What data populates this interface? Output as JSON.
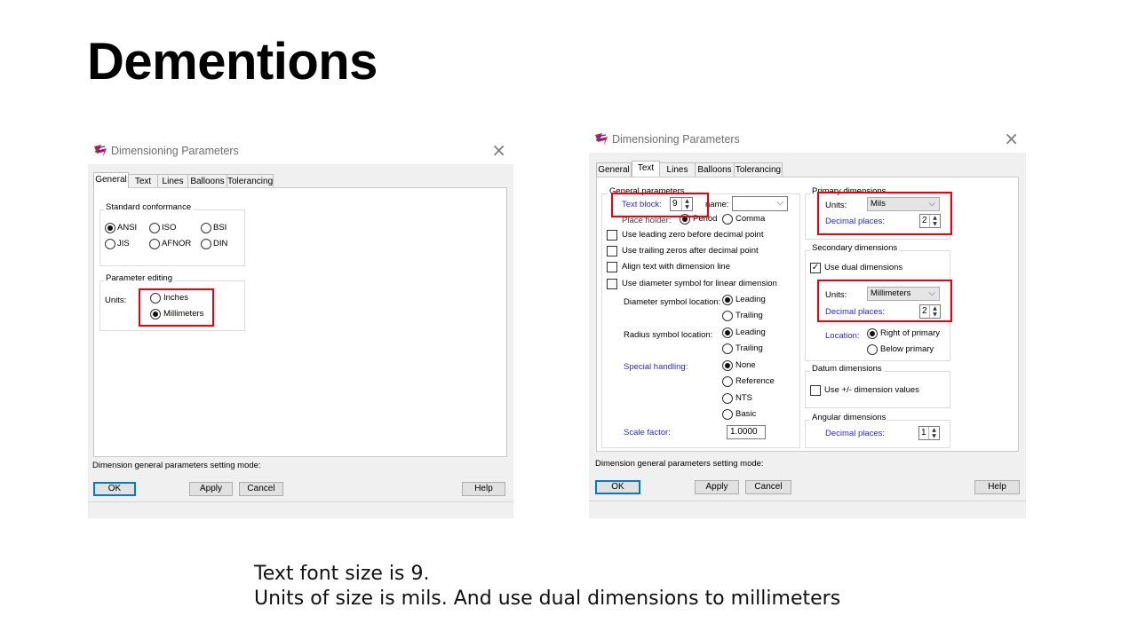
{
  "slide": {
    "title": "Dementions",
    "caption_line1": "Text font size is 9.",
    "caption_line2": "Units of size is mils. And use dual dimensions to millimeters"
  },
  "colors": {
    "highlight": "#e60012",
    "blue_label": "#2a2ad0",
    "dialog_bg": "#f0f0f0"
  },
  "dialog_left": {
    "title": "Dimensioning Parameters",
    "tabs": [
      "General",
      "Text",
      "Lines",
      "Balloons",
      "Tolerancing"
    ],
    "active_tab": "General",
    "standard_conformance": {
      "label": "Standard conformance",
      "options": [
        "ANSI",
        "ISO",
        "BSI",
        "JIS",
        "AFNOR",
        "DIN"
      ],
      "selected": "ANSI"
    },
    "parameter_editing": {
      "label": "Parameter editing",
      "units_label": "Units:",
      "options": [
        "Inches",
        "Millimeters"
      ],
      "selected": "Millimeters"
    },
    "status_text": "Dimension general parameters setting mode:",
    "buttons": {
      "ok": "OK",
      "apply": "Apply",
      "cancel": "Cancel",
      "help": "Help"
    }
  },
  "dialog_right": {
    "title": "Dimensioning Parameters",
    "tabs": [
      "General",
      "Text",
      "Lines",
      "Balloons",
      "Tolerancing"
    ],
    "active_tab": "Text",
    "general_parameters": {
      "label": "General parameters",
      "text_block_label": "Text block:",
      "text_block_value": "9",
      "name_label": "name:",
      "name_value": "",
      "place_holder_label": "Place holder:",
      "place_holder_options": [
        "Period",
        "Comma"
      ],
      "place_holder_selected": "Period",
      "checkboxes": [
        "Use leading zero before decimal point",
        "Use trailing zeros after decimal point",
        "Align text with dimension line",
        "Use diameter symbol for linear dimension"
      ],
      "diameter_label": "Diameter symbol location:",
      "diameter_options": [
        "Leading",
        "Trailing"
      ],
      "diameter_selected": "Leading",
      "radius_label": "Radius symbol location:",
      "radius_options": [
        "Leading",
        "Trailing"
      ],
      "radius_selected": "Leading",
      "special_label": "Special handling:",
      "special_options": [
        "None",
        "Reference",
        "NTS",
        "Basic"
      ],
      "special_selected": "None",
      "scale_label": "Scale factor:",
      "scale_value": "1.0000"
    },
    "primary_dimensions": {
      "label": "Primary dimensions",
      "units_label": "Units:",
      "units_value": "Mils",
      "decimal_label": "Decimal places:",
      "decimal_value": "2"
    },
    "secondary_dimensions": {
      "label": "Secondary dimensions",
      "dual_label": "Use dual dimensions",
      "dual_checked": true,
      "units_label": "Units:",
      "units_value": "Millimeters",
      "decimal_label": "Decimal places:",
      "decimal_value": "2",
      "location_label": "Location:",
      "location_options": [
        "Right of primary",
        "Below primary"
      ],
      "location_selected": "Right of primary"
    },
    "datum_dimensions": {
      "label": "Datum dimensions",
      "check_label": "Use +/- dimension values",
      "checked": false
    },
    "angular_dimensions": {
      "label": "Angular dimensions",
      "decimal_label": "Decimal places:",
      "decimal_value": "1"
    },
    "status_text": "Dimension general parameters setting mode:",
    "buttons": {
      "ok": "OK",
      "apply": "Apply",
      "cancel": "Cancel",
      "help": "Help"
    }
  }
}
